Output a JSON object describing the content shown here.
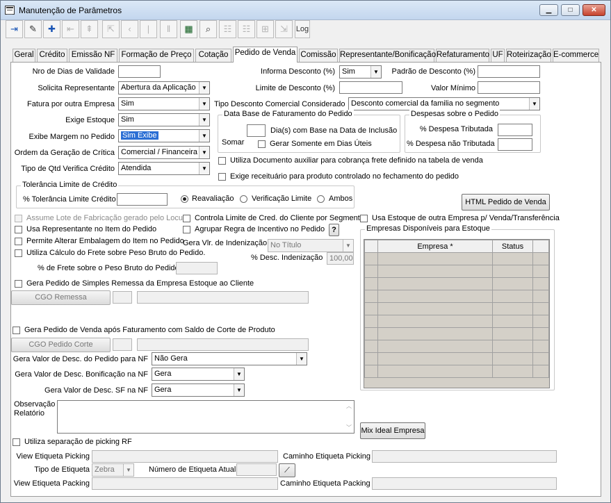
{
  "window": {
    "title": "Manutenção de Parâmetros",
    "btn_min": "▁",
    "btn_max": "□",
    "btn_close": "✕"
  },
  "toolbar": {
    "log_label": "Log",
    "icons": [
      "exit-icon",
      "eraser-icon",
      "add-record-icon",
      "prev-page-icon",
      "first-record-icon",
      "prev-record-icon",
      "next-record-icon",
      "next-page-icon",
      "last-record-icon",
      "grid-view-icon",
      "binoculars-icon",
      "filter-icon",
      "filter-clear-icon",
      "tree-icon",
      "export-icon"
    ]
  },
  "tabs": [
    "Geral",
    "Crédito",
    "Emissão NF",
    "Formação de Preço",
    "Cotação",
    "Pedido de Venda",
    "Comissão",
    "Representante/Bonificação",
    "Refaturamento",
    "UF",
    "Roteirização",
    "E-commerce"
  ],
  "active_tab": "Pedido de Venda",
  "form": {
    "dias_validade": {
      "label": "Nro de Dias de Validade",
      "value": ""
    },
    "solicita_rep": {
      "label": "Solicita Representante",
      "value": "Abertura da Aplicação"
    },
    "fatura_outra": {
      "label": "Fatura por outra Empresa",
      "value": "Sim"
    },
    "exige_estoque": {
      "label": "Exige Estoque",
      "value": "Sim"
    },
    "exibe_margem": {
      "label": "Exibe Margem no Pedido",
      "value": "Sim Exibe"
    },
    "ordem_critica": {
      "label": "Ordem da Geração de Crítica",
      "value": "Comercial / Financeira"
    },
    "tipo_qtd": {
      "label": "Tipo de Qtd Verifica Crédito",
      "value": "Atendida"
    },
    "informa_desc": {
      "label": "Informa Desconto (%)",
      "value": "Sim"
    },
    "padrao_desc": {
      "label": "Padrão de Desconto (%)",
      "value": ""
    },
    "limite_desc": {
      "label": "Limite de Desconto (%)",
      "value": ""
    },
    "valor_min": {
      "label": "Valor Mínimo",
      "value": ""
    },
    "tipo_desc": {
      "label": "Tipo Desconto Comercial Considerado",
      "value": "Desconto comercial da familia no segmento"
    },
    "data_base": {
      "title": "Data Base de Faturamento do Pedido",
      "somar": "Somar",
      "dias_label": "Dia(s)  com Base na Data de Inclusão",
      "dias_value": "",
      "uteis": "Gerar Somente em Dias Úteis"
    },
    "despesas": {
      "title": "Despesas sobre o Pedido",
      "trib": "% Despesa Tributada",
      "nao_trib": "% Despesa não Tributada",
      "trib_value": "",
      "nao_trib_value": ""
    },
    "doc_aux": "Utiliza Documento auxiliar para cobrança frete definido na tabela de venda",
    "receituario": "Exige receituário para produto controlado no fechamento do pedido",
    "tolerancia": {
      "title": "Tolerância Limite de Crédito",
      "label": "% Tolerância Limite Crédito",
      "value": "",
      "opts": [
        "Reavaliação",
        "Verificação Limite",
        "Ambos"
      ]
    },
    "html_btn": "HTML Pedido de Venda",
    "assume_lote": "Assume Lote de Fabricação gerado pelo Locus",
    "usa_rep_item": "Usa Representante no Item do Pedido",
    "permite_emb": "Permite Alterar Embalagem do Item no Pedido",
    "calc_frete": "Utiliza Cálculo do Frete sobre Peso Bruto do Pedido.",
    "pct_frete": "% de Frete sobre o Peso Bruto do Pedido",
    "controla_limite": "Controla Limite de Cred. do Cliente por Segmento",
    "agrupar": "Agrupar Regra de Incentivo no Pedido",
    "help": "?",
    "gera_vlr_ind": "Gera Vlr. de Indenização",
    "gera_vlr_ind_value": "No Título",
    "desc_ind": "% Desc. Indenização",
    "desc_ind_value": "100,00",
    "usa_estoque_outra": "Usa Estoque de outra Empresa p/ Venda/Transferência",
    "empresas": {
      "title": "Empresas Disponíveis para Estoque",
      "cols": [
        "Empresa *",
        "Status"
      ]
    },
    "simples_remessa": "Gera Pedido de Simples Remessa da Empresa Estoque ao Cliente",
    "cgo_remessa": "CGO Remessa",
    "pedido_corte": "Gera Pedido de Venda após Faturamento com Saldo de Corte de Produto",
    "cgo_corte": "CGO Pedido Corte",
    "gera_desc_nf": {
      "label": "Gera Valor de Desc. do Pedido para NF",
      "value": "Não Gera"
    },
    "gera_desc_bon": {
      "label": "Gera Valor de Desc. Bonificação na NF",
      "value": "Gera"
    },
    "gera_desc_sf": {
      "label": "Gera Valor de Desc. SF na NF",
      "value": "Gera"
    },
    "obs_label": "Observação\nRelatório",
    "mix_btn": "Mix Ideal Empresa",
    "picking_rf": "Utiliza separação de picking RF",
    "view_picking": "View Etiqueta Picking",
    "caminho_picking": "Caminho Etiqueta Picking",
    "tipo_etiqueta": "Tipo de Etiqueta",
    "tipo_etiqueta_value": "Zebra",
    "num_etiqueta": "Número de Etiqueta Atual",
    "view_packing": "View Etiqueta Packing",
    "caminho_packing": "Caminho Etiqueta Packing"
  }
}
